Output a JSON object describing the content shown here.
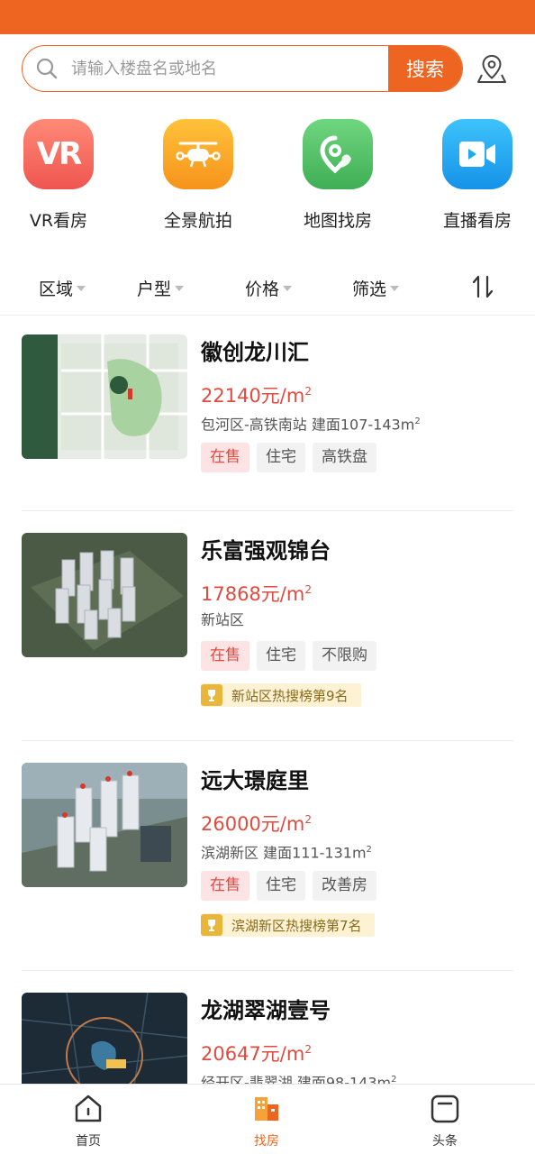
{
  "search": {
    "placeholder": "请输入楼盘名或地名",
    "button_label": "搜索"
  },
  "quick_nav": [
    {
      "label": "VR看房",
      "icon": "vr-icon",
      "color": "#f4685f"
    },
    {
      "label": "全景航拍",
      "icon": "drone-icon",
      "color": "#f9a823"
    },
    {
      "label": "地图找房",
      "icon": "map-pin-icon",
      "color": "#4fc265"
    },
    {
      "label": "直播看房",
      "icon": "video-icon",
      "color": "#1da8ef"
    }
  ],
  "filters": [
    "区域",
    "户型",
    "价格",
    "筛选"
  ],
  "listings": [
    {
      "name": "徽创龙川汇",
      "price": "22140元/m",
      "price_sup": "2",
      "area": "包河区-高铁南站  建面107-143m",
      "area_sup": "2",
      "tags": [
        "在售",
        "住宅",
        "高铁盘"
      ],
      "rank": ""
    },
    {
      "name": "乐富强观锦台",
      "price": "17868元/m",
      "price_sup": "2",
      "area": "新站区",
      "area_sup": "",
      "tags": [
        "在售",
        "住宅",
        "不限购"
      ],
      "rank": "新站区热搜榜第9名"
    },
    {
      "name": "远大璟庭里",
      "price": "26000元/m",
      "price_sup": "2",
      "area": "滨湖新区  建面111-131m",
      "area_sup": "2",
      "tags": [
        "在售",
        "住宅",
        "改善房"
      ],
      "rank": "滨湖新区热搜榜第7名"
    },
    {
      "name": "龙湖翠湖壹号",
      "price": "20647元/m",
      "price_sup": "2",
      "area": "经开区-翡翠湖  建面98-143m",
      "area_sup": "2",
      "tags": [],
      "rank": ""
    }
  ],
  "bottom_nav": [
    {
      "label": "首页",
      "icon": "home-icon"
    },
    {
      "label": "找房",
      "icon": "building-icon",
      "active": true
    },
    {
      "label": "头条",
      "icon": "news-icon"
    }
  ],
  "colors": {
    "accent": "#ee6522",
    "price": "#e04a3f"
  }
}
